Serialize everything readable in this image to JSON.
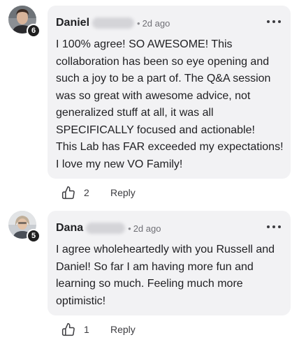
{
  "comments": [
    {
      "author": "Daniel",
      "level": "6",
      "time": "2d ago",
      "text": "I 100% agree! SO AWESOME! This\ncollaboration has been so eye opening and\nsuch a joy to be a part of. The Q&A session\nwas so great with awesome advice, not\ngeneralized stuff at all, it was all\nSPECIFICALLY focused and actionable!\nThis Lab has FAR exceeded my expectations!\nI love my new VO Family!",
      "likes": "2",
      "reply_label": "Reply",
      "more_icon": "more-horizontal-icon",
      "like_icon": "thumbs-up-icon"
    },
    {
      "author": "Dana",
      "level": "5",
      "time": "2d ago",
      "text": "I agree wholeheartedly with you Russell and\nDaniel! So far I am having more fun and\nlearning so much. Feeling much more\noptimistic!",
      "likes": "1",
      "reply_label": "Reply",
      "more_icon": "more-horizontal-icon",
      "like_icon": "thumbs-up-icon"
    }
  ]
}
